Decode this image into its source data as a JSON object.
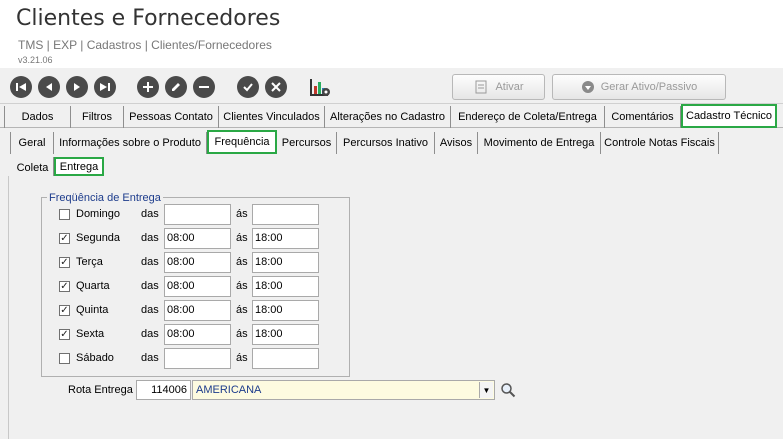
{
  "header": {
    "title": "Clientes e Fornecedores",
    "breadcrumb": "TMS | EXP | Cadastros | Clientes/Fornecedores",
    "version": "v3.21.06"
  },
  "toolbar": {
    "nav_icons": [
      "first-record-icon",
      "previous-record-icon",
      "next-record-icon",
      "last-record-icon"
    ],
    "edit_icons": [
      "add-icon",
      "edit-icon",
      "remove-icon"
    ],
    "confirm_icons": [
      "confirm-icon",
      "cancel-icon"
    ],
    "chart_icon": "chart-settings-icon",
    "ativar_label": "Ativar",
    "gerar_label": "Gerar Ativo/Passivo"
  },
  "tabs_main": [
    "Dados",
    "Filtros",
    "Pessoas Contato",
    "Clientes Vinculados",
    "Alterações no Cadastro",
    "Endereço de Coleta/Entrega",
    "Comentários",
    "Cadastro Técnico"
  ],
  "tabs_tecnico": [
    "Geral",
    "Informações sobre o Produto",
    "Frequência",
    "Percursos",
    "Percursos Inativo",
    "Avisos",
    "Movimento de Entrega",
    "Controle Notas Fiscais"
  ],
  "tabs_freq": [
    "Coleta",
    "Entrega"
  ],
  "frequencia": {
    "legend": "Freqüência de Entrega",
    "das_label": "das",
    "as_label": "ás",
    "days": [
      {
        "label": "Domingo",
        "checked": false,
        "from": "",
        "to": ""
      },
      {
        "label": "Segunda",
        "checked": true,
        "from": "08:00",
        "to": "18:00"
      },
      {
        "label": "Terça",
        "checked": true,
        "from": "08:00",
        "to": "18:00"
      },
      {
        "label": "Quarta",
        "checked": true,
        "from": "08:00",
        "to": "18:00"
      },
      {
        "label": "Quinta",
        "checked": true,
        "from": "08:00",
        "to": "18:00"
      },
      {
        "label": "Sexta",
        "checked": true,
        "from": "08:00",
        "to": "18:00"
      },
      {
        "label": "Sábado",
        "checked": false,
        "from": "",
        "to": ""
      }
    ]
  },
  "rota": {
    "label": "Rota Entrega",
    "code": "114006",
    "value": "AMERICANA"
  },
  "colors": {
    "highlight": "#2aa845",
    "legend_text": "#1d3c8c",
    "select_bg": "#fdfbe0"
  }
}
